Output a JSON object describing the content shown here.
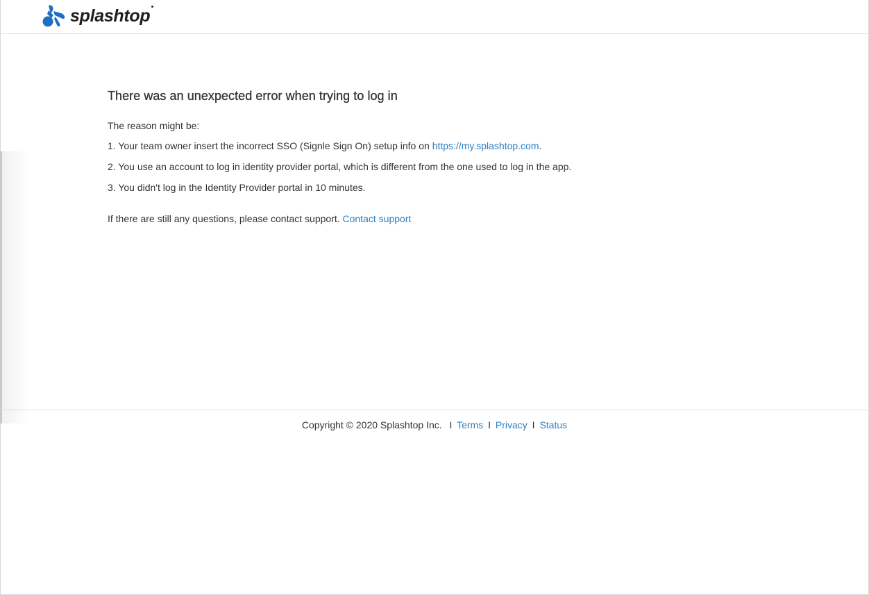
{
  "header": {
    "logo_text": "splashtop",
    "logo_icon": "splashtop-logo-icon"
  },
  "main": {
    "title": "There was an unexpected error when trying to log in",
    "reason_intro": "The reason might be:",
    "reasons": [
      {
        "text_before": "1. Your team owner insert the incorrect SSO (Signle Sign On) setup info on ",
        "link": "https://my.splashtop.com",
        "text_after": "."
      },
      {
        "text": "2. You use an account to log in identity provider portal, which is different from the one used to log in the app."
      },
      {
        "text": "3. You didn't log in the Identity Provider portal in 10 minutes."
      }
    ],
    "support_text": "If there are still any questions, please contact support. ",
    "support_link": "Contact support"
  },
  "footer": {
    "copyright": "Copyright © 2020 Splashtop Inc.",
    "separator": "I",
    "terms": "Terms",
    "privacy": "Privacy",
    "status": "Status"
  },
  "colors": {
    "link": "#2b7fc3",
    "brand_blue": "#1d6fc4",
    "text": "#333333"
  }
}
